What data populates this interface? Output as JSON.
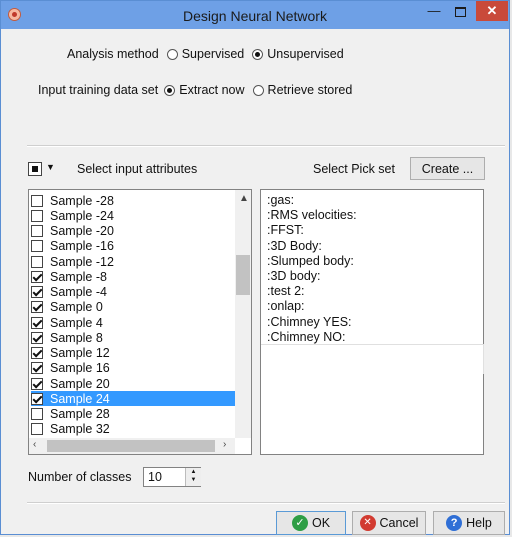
{
  "window": {
    "title": "Design Neural Network",
    "min_glyph": "—",
    "close_glyph": "✕"
  },
  "analysis": {
    "label": "Analysis method",
    "options": [
      "Supervised",
      "Unsupervised"
    ],
    "selected": "Unsupervised"
  },
  "input_set": {
    "label": "Input training data set",
    "options": [
      "Extract now",
      "Retrieve stored"
    ],
    "selected": "Extract now"
  },
  "attributes": {
    "label": "Select input attributes",
    "items": [
      {
        "label": "Sample -28",
        "checked": false
      },
      {
        "label": "Sample -24",
        "checked": false
      },
      {
        "label": "Sample -20",
        "checked": false
      },
      {
        "label": "Sample -16",
        "checked": false
      },
      {
        "label": "Sample -12",
        "checked": false
      },
      {
        "label": "Sample -8",
        "checked": true
      },
      {
        "label": "Sample -4",
        "checked": true
      },
      {
        "label": "Sample 0",
        "checked": true
      },
      {
        "label": "Sample 4",
        "checked": true
      },
      {
        "label": "Sample 8",
        "checked": true
      },
      {
        "label": "Sample 12",
        "checked": true
      },
      {
        "label": "Sample 16",
        "checked": true
      },
      {
        "label": "Sample 20",
        "checked": true
      },
      {
        "label": "Sample 24",
        "checked": true,
        "selected": true
      },
      {
        "label": "Sample 28",
        "checked": false
      },
      {
        "label": "Sample 32",
        "checked": false
      }
    ]
  },
  "pickset": {
    "label": "Select Pick set",
    "create_button": "Create ...",
    "items": [
      ":gas:",
      ":RMS velocities:",
      ":FFST:",
      ":3D Body:",
      ":Slumped body:",
      ":3D body:",
      ":test 2:",
      ":onlap:",
      ":Chimney YES:",
      ":Chimney NO:"
    ]
  },
  "classes": {
    "label": "Number of classes",
    "value": "10"
  },
  "footer": {
    "ok": "OK",
    "cancel": "Cancel",
    "help": "Help"
  }
}
